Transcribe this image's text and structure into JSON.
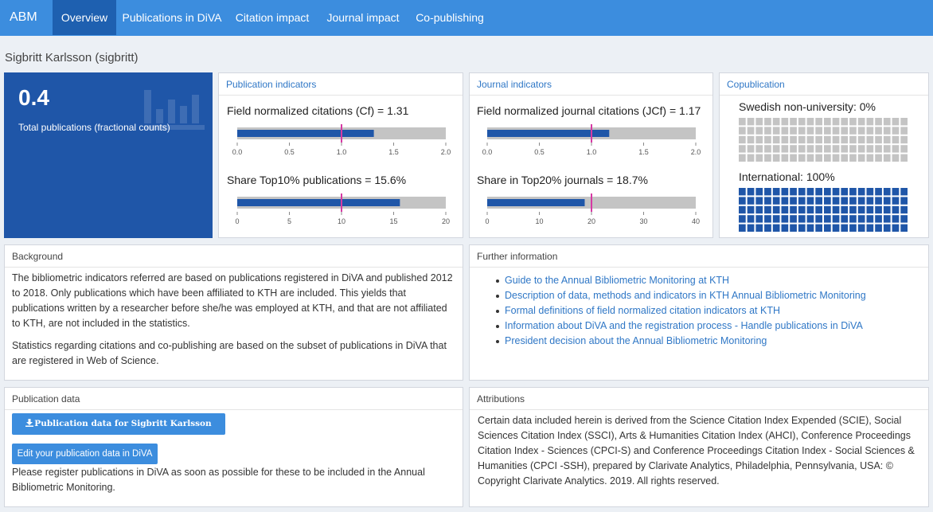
{
  "nav": {
    "brand": "ABM",
    "tabs": [
      {
        "label": "Overview",
        "active": true
      },
      {
        "label": "Publications in DiVA",
        "active": false
      },
      {
        "label": "Citation impact",
        "active": false
      },
      {
        "label": "Journal impact",
        "active": false
      },
      {
        "label": "Co-publishing",
        "active": false
      }
    ]
  },
  "page_title": "Sigbritt Karlsson (sigbritt)",
  "kpi": {
    "value": "0.4",
    "label": "Total publications (fractional counts)"
  },
  "publication_indicators": {
    "title": "Publication indicators",
    "cf": {
      "label": "Field normalized citations (Cf) = 1.31",
      "value": 1.31,
      "reference": 1.0,
      "max": 2.0,
      "ticks": [
        "0.0",
        "0.5",
        "1.0",
        "1.5",
        "2.0"
      ]
    },
    "top10": {
      "label": "Share Top10% publications = 15.6%",
      "value": 15.6,
      "reference": 10,
      "max": 20,
      "ticks": [
        "0",
        "5",
        "10",
        "15",
        "20"
      ]
    }
  },
  "journal_indicators": {
    "title": "Journal indicators",
    "jcf": {
      "label": "Field normalized journal citations (JCf) = 1.17",
      "value": 1.17,
      "reference": 1.0,
      "max": 2.0,
      "ticks": [
        "0.0",
        "0.5",
        "1.0",
        "1.5",
        "2.0"
      ]
    },
    "top20": {
      "label": "Share in Top20% journals = 18.7%",
      "value": 18.7,
      "reference": 20,
      "max": 40,
      "ticks": [
        "0",
        "10",
        "20",
        "30",
        "40"
      ]
    }
  },
  "copublication": {
    "title": "Copublication",
    "swedish": {
      "label": "Swedish non-university: 0%",
      "percent": 0
    },
    "international": {
      "label": "International: 100%",
      "percent": 100
    }
  },
  "background": {
    "title": "Background",
    "p1": "The bibliometric indicators referred are based on publications registered in DiVA and published 2012 to 2018. Only publications which have been affiliated to KTH are included. This yields that publications written by a researcher before she/he was employed at KTH, and that are not affiliated to KTH, are not included in the statistics.",
    "p2": "Statistics regarding citations and co-publishing are based on the subset of publications in DiVA that are registered in Web of Science."
  },
  "further_info": {
    "title": "Further information",
    "links": [
      "Guide to the Annual Bibliometric Monitoring at KTH",
      "Description of data, methods and indicators in KTH Annual Bibliometric Monitoring",
      "Formal definitions of field normalized citation indicators at KTH",
      "Information about DiVA and the registration process - Handle publications in DiVA",
      "President decision about the Annual Bibliometric Monitoring"
    ]
  },
  "publication_data": {
    "title": "Publication data",
    "download_button": "Publication data for Sigbritt Karlsson (sigbritt)",
    "edit_button": "Edit your publication data in DiVA",
    "note": "Please register publications in DiVA as soon as possible for these to be included in the Annual Bibliometric Monitoring."
  },
  "attributions": {
    "title": "Attributions",
    "text": "Certain data included herein is derived from the Science Citation Index Expended (SCIE), Social Sciences Citation Index (SSCI), Arts & Humanities Citation Index (AHCI), Conference Proceedings Citation Index - Sciences (CPCI-S) and Conference Proceedings Citation Index - Social Sciences & Humanities (CPCI -SSH), prepared by Clarivate Analytics, Philadelphia, Pennsylvania, USA: © Copyright Clarivate Analytics. 2019. All rights reserved."
  },
  "colors": {
    "nav": "#3c8dde",
    "active_tab": "#1e60b0",
    "kpi_bg": "#1f56a8",
    "bar": "#1f56a8",
    "track": "#c4c4c4",
    "reference": "#d63aa3",
    "waffle_on": "#1f56a8",
    "waffle_off": "#c4c4c4"
  }
}
